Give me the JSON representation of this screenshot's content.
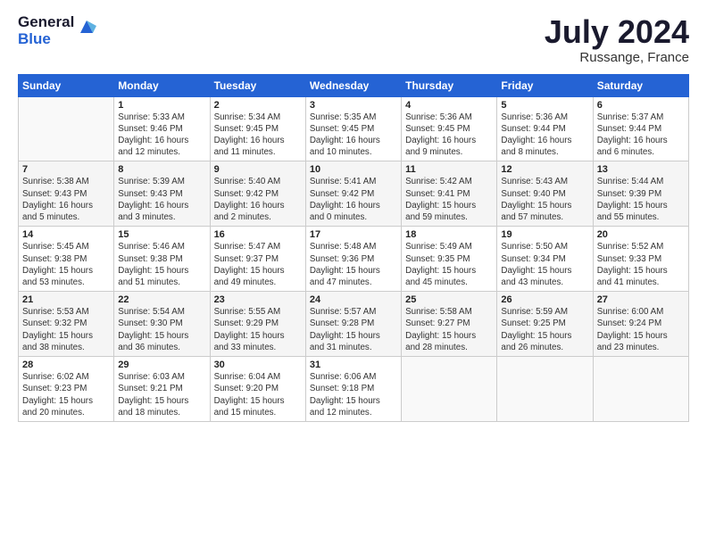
{
  "logo": {
    "general": "General",
    "blue": "Blue"
  },
  "title": "July 2024",
  "subtitle": "Russange, France",
  "days_header": [
    "Sunday",
    "Monday",
    "Tuesday",
    "Wednesday",
    "Thursday",
    "Friday",
    "Saturday"
  ],
  "weeks": [
    [
      {
        "day": "",
        "info": ""
      },
      {
        "day": "1",
        "info": "Sunrise: 5:33 AM\nSunset: 9:46 PM\nDaylight: 16 hours\nand 12 minutes."
      },
      {
        "day": "2",
        "info": "Sunrise: 5:34 AM\nSunset: 9:45 PM\nDaylight: 16 hours\nand 11 minutes."
      },
      {
        "day": "3",
        "info": "Sunrise: 5:35 AM\nSunset: 9:45 PM\nDaylight: 16 hours\nand 10 minutes."
      },
      {
        "day": "4",
        "info": "Sunrise: 5:36 AM\nSunset: 9:45 PM\nDaylight: 16 hours\nand 9 minutes."
      },
      {
        "day": "5",
        "info": "Sunrise: 5:36 AM\nSunset: 9:44 PM\nDaylight: 16 hours\nand 8 minutes."
      },
      {
        "day": "6",
        "info": "Sunrise: 5:37 AM\nSunset: 9:44 PM\nDaylight: 16 hours\nand 6 minutes."
      }
    ],
    [
      {
        "day": "7",
        "info": "Sunrise: 5:38 AM\nSunset: 9:43 PM\nDaylight: 16 hours\nand 5 minutes."
      },
      {
        "day": "8",
        "info": "Sunrise: 5:39 AM\nSunset: 9:43 PM\nDaylight: 16 hours\nand 3 minutes."
      },
      {
        "day": "9",
        "info": "Sunrise: 5:40 AM\nSunset: 9:42 PM\nDaylight: 16 hours\nand 2 minutes."
      },
      {
        "day": "10",
        "info": "Sunrise: 5:41 AM\nSunset: 9:42 PM\nDaylight: 16 hours\nand 0 minutes."
      },
      {
        "day": "11",
        "info": "Sunrise: 5:42 AM\nSunset: 9:41 PM\nDaylight: 15 hours\nand 59 minutes."
      },
      {
        "day": "12",
        "info": "Sunrise: 5:43 AM\nSunset: 9:40 PM\nDaylight: 15 hours\nand 57 minutes."
      },
      {
        "day": "13",
        "info": "Sunrise: 5:44 AM\nSunset: 9:39 PM\nDaylight: 15 hours\nand 55 minutes."
      }
    ],
    [
      {
        "day": "14",
        "info": "Sunrise: 5:45 AM\nSunset: 9:38 PM\nDaylight: 15 hours\nand 53 minutes."
      },
      {
        "day": "15",
        "info": "Sunrise: 5:46 AM\nSunset: 9:38 PM\nDaylight: 15 hours\nand 51 minutes."
      },
      {
        "day": "16",
        "info": "Sunrise: 5:47 AM\nSunset: 9:37 PM\nDaylight: 15 hours\nand 49 minutes."
      },
      {
        "day": "17",
        "info": "Sunrise: 5:48 AM\nSunset: 9:36 PM\nDaylight: 15 hours\nand 47 minutes."
      },
      {
        "day": "18",
        "info": "Sunrise: 5:49 AM\nSunset: 9:35 PM\nDaylight: 15 hours\nand 45 minutes."
      },
      {
        "day": "19",
        "info": "Sunrise: 5:50 AM\nSunset: 9:34 PM\nDaylight: 15 hours\nand 43 minutes."
      },
      {
        "day": "20",
        "info": "Sunrise: 5:52 AM\nSunset: 9:33 PM\nDaylight: 15 hours\nand 41 minutes."
      }
    ],
    [
      {
        "day": "21",
        "info": "Sunrise: 5:53 AM\nSunset: 9:32 PM\nDaylight: 15 hours\nand 38 minutes."
      },
      {
        "day": "22",
        "info": "Sunrise: 5:54 AM\nSunset: 9:30 PM\nDaylight: 15 hours\nand 36 minutes."
      },
      {
        "day": "23",
        "info": "Sunrise: 5:55 AM\nSunset: 9:29 PM\nDaylight: 15 hours\nand 33 minutes."
      },
      {
        "day": "24",
        "info": "Sunrise: 5:57 AM\nSunset: 9:28 PM\nDaylight: 15 hours\nand 31 minutes."
      },
      {
        "day": "25",
        "info": "Sunrise: 5:58 AM\nSunset: 9:27 PM\nDaylight: 15 hours\nand 28 minutes."
      },
      {
        "day": "26",
        "info": "Sunrise: 5:59 AM\nSunset: 9:25 PM\nDaylight: 15 hours\nand 26 minutes."
      },
      {
        "day": "27",
        "info": "Sunrise: 6:00 AM\nSunset: 9:24 PM\nDaylight: 15 hours\nand 23 minutes."
      }
    ],
    [
      {
        "day": "28",
        "info": "Sunrise: 6:02 AM\nSunset: 9:23 PM\nDaylight: 15 hours\nand 20 minutes."
      },
      {
        "day": "29",
        "info": "Sunrise: 6:03 AM\nSunset: 9:21 PM\nDaylight: 15 hours\nand 18 minutes."
      },
      {
        "day": "30",
        "info": "Sunrise: 6:04 AM\nSunset: 9:20 PM\nDaylight: 15 hours\nand 15 minutes."
      },
      {
        "day": "31",
        "info": "Sunrise: 6:06 AM\nSunset: 9:18 PM\nDaylight: 15 hours\nand 12 minutes."
      },
      {
        "day": "",
        "info": ""
      },
      {
        "day": "",
        "info": ""
      },
      {
        "day": "",
        "info": ""
      }
    ]
  ]
}
